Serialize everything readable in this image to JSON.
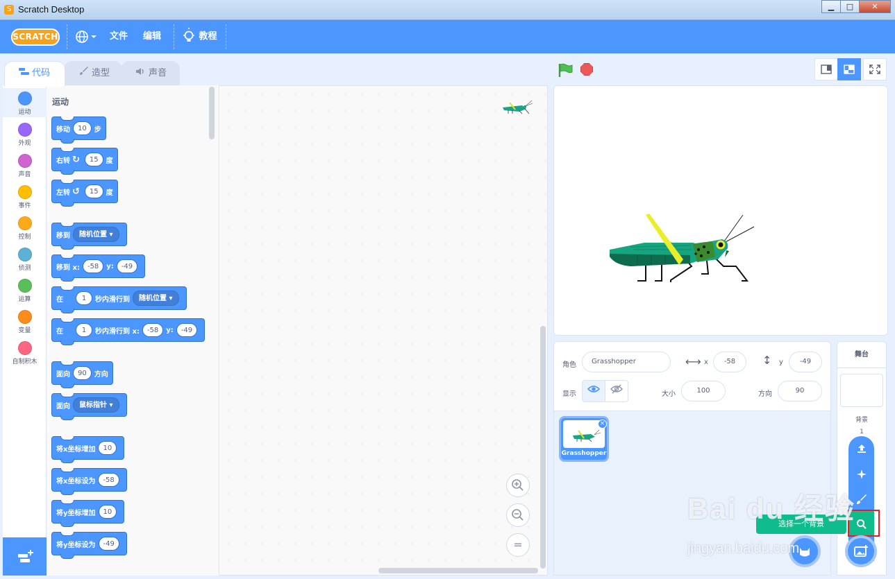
{
  "window": {
    "title": "Scratch Desktop",
    "minimize": "▁",
    "maximize": "□",
    "close": "✕"
  },
  "menubar": {
    "logo": "SCRATCH",
    "file": "文件",
    "edit": "编辑",
    "tutorials": "教程"
  },
  "tabs": {
    "code": "代码",
    "costumes": "造型",
    "sounds": "声音"
  },
  "categories": [
    {
      "label": "运动",
      "color": "#4c97ff"
    },
    {
      "label": "外观",
      "color": "#9966ff"
    },
    {
      "label": "声音",
      "color": "#cf63cf"
    },
    {
      "label": "事件",
      "color": "#ffbf00"
    },
    {
      "label": "控制",
      "color": "#ffab19"
    },
    {
      "label": "侦测",
      "color": "#5cb1d6"
    },
    {
      "label": "运算",
      "color": "#59c059"
    },
    {
      "label": "变量",
      "color": "#ff8c1a"
    },
    {
      "label": "自制积木",
      "color": "#ff6680"
    }
  ],
  "palette": {
    "section": "运动",
    "move": {
      "a": "移动",
      "v": "10",
      "b": "步"
    },
    "turn_right": {
      "a": "右转",
      "v": "15",
      "b": "度"
    },
    "turn_left": {
      "a": "左转",
      "v": "15",
      "b": "度"
    },
    "goto": {
      "a": "移到",
      "dd": "随机位置"
    },
    "goto_xy": {
      "a": "移到 x:",
      "x": "-58",
      "b": "y:",
      "y": "-49"
    },
    "glide": {
      "a": "在",
      "v": "1",
      "b": "秒内滑行到",
      "dd": "随机位置"
    },
    "glide_xy": {
      "a": "在",
      "v": "1",
      "b": "秒内滑行到 x:",
      "x": "-58",
      "c": "y:",
      "y": "-49"
    },
    "point_dir": {
      "a": "面向",
      "v": "90",
      "b": "方向"
    },
    "point_towards": {
      "a": "面向",
      "dd": "鼠标指针"
    },
    "change_x": {
      "a": "将x坐标增加",
      "v": "10"
    },
    "set_x": {
      "a": "将x坐标设为",
      "v": "-58"
    },
    "change_y": {
      "a": "将y坐标增加",
      "v": "10"
    },
    "set_y": {
      "a": "将y坐标设为",
      "v": "-49"
    }
  },
  "zoom": {
    "in": "+",
    "out": "−",
    "reset": "="
  },
  "sprite_info": {
    "sprite_label": "角色",
    "sprite_name": "Grasshopper",
    "x_label": "x",
    "x": "-58",
    "y_label": "y",
    "y": "-49",
    "show_label": "显示",
    "size_label": "大小",
    "size": "100",
    "direction_label": "方向",
    "direction": "90"
  },
  "sprite_list": [
    {
      "name": "Grasshopper"
    }
  ],
  "stage_pane": {
    "title": "舞台",
    "backdrop_label": "背景",
    "backdrop_count": "1"
  },
  "tooltip": "选择一个背景",
  "watermark": {
    "logo": "Bai du 经验",
    "url": "jingyan.baidu.com"
  },
  "colors": {
    "accent": "#4c97ff",
    "search": "#0fbd8c",
    "highlight": "#e02020"
  }
}
